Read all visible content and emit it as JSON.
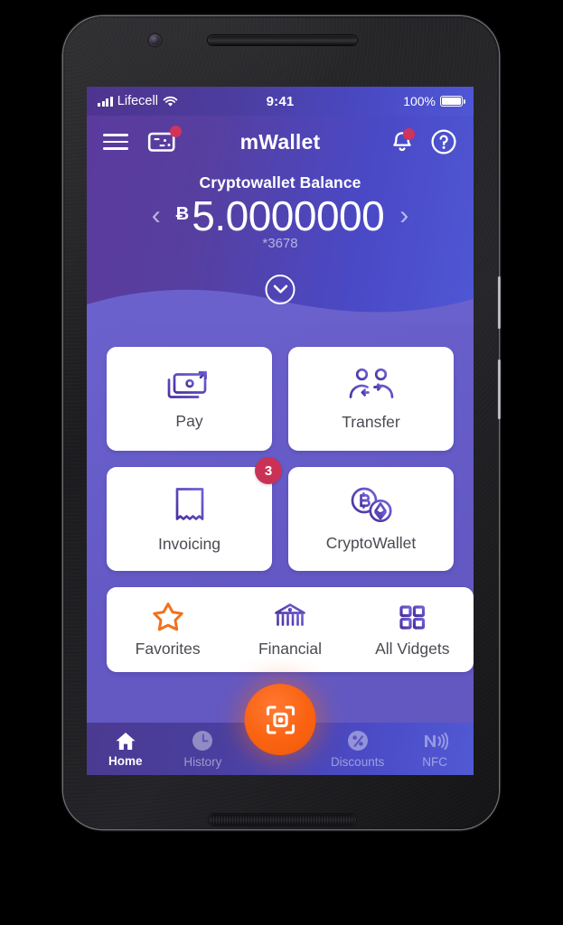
{
  "statusbar": {
    "carrier": "Lifecell",
    "time": "9:41",
    "battery_pct": "100%",
    "icons": {
      "signal": "signal-bars-icon",
      "wifi": "wifi-icon",
      "battery": "battery-icon"
    }
  },
  "header": {
    "app_title": "mWallet",
    "menu_icon": "hamburger-menu-icon",
    "cards_icon": "bank-card-icon",
    "bell_icon": "notification-bell-icon",
    "help_icon": "question-mark-help-icon",
    "balance": {
      "label": "Cryptowallet Balance",
      "currency_symbol": "Ƀ",
      "amount": "5.0000000",
      "account_mask": "*3678",
      "prev_arrow": "‹",
      "next_arrow": "›",
      "expand_icon": "chevron-down-circle-icon"
    }
  },
  "main": {
    "cards": [
      {
        "label": "Pay",
        "icon": "banknotes-arrow-icon",
        "badge": null
      },
      {
        "label": "Transfer",
        "icon": "two-people-swap-icon",
        "badge": null
      },
      {
        "label": "Invoicing",
        "icon": "invoice-receipt-icon",
        "badge": "3"
      },
      {
        "label": "CryptoWallet",
        "icon": "bitcoin-ethereum-coins-icon",
        "badge": null
      }
    ],
    "widgets": [
      {
        "label": "Favorites",
        "icon": "star-outline-icon",
        "color": "#f2711c"
      },
      {
        "label": "Financial",
        "icon": "bank-building-icon",
        "color": "#5b4fc0"
      },
      {
        "label": "All Vidgets",
        "icon": "grid-squares-icon",
        "color": "#5b4fc0"
      }
    ]
  },
  "tabbar": {
    "items": [
      {
        "label": "Home",
        "icon": "home-icon",
        "active": true
      },
      {
        "label": "History",
        "icon": "clock-icon",
        "active": false
      },
      {
        "label": "Discounts",
        "icon": "percent-icon",
        "active": false
      },
      {
        "label": "NFC",
        "icon": "nfc-waves-icon",
        "active": false
      }
    ],
    "scan_button": {
      "icon": "qr-scan-icon",
      "color": "#fa6312"
    }
  },
  "colors": {
    "header_from": "#5b3a9e",
    "header_to": "#4f57d4",
    "body": "#6459c4",
    "accent_orange": "#fa6312",
    "badge_red": "#c93256",
    "icon_purple": "#5b4fc0"
  }
}
